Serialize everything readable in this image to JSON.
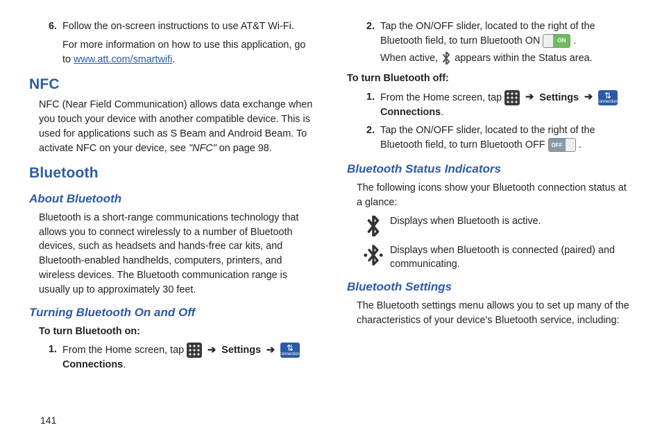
{
  "left": {
    "item6_a": "Follow the on-screen instructions to use AT&T Wi-Fi.",
    "item6_b": "For more information on how to use this application, go to ",
    "link": "www.att.com/smartwifi",
    "nfc_h": "NFC",
    "nfc_p1": "NFC (Near Field Communication) allows data exchange when you touch your device with another compatible device. This is used for applications such as S Beam and Android Beam. To activate NFC on your device, see ",
    "nfc_ref": "\"NFC\"",
    "nfc_p2": " on page 98.",
    "bt_h": "Bluetooth",
    "about_h": "About Bluetooth",
    "about_p": "Bluetooth is a short-range communications technology that allows you to connect wirelessly to a number of Bluetooth devices, such as headsets and hands-free car kits, and Bluetooth-enabled handhelds, computers, printers, and wireless devices. The Bluetooth communication range is usually up to approximately 30 feet.",
    "turn_h": "Turning Bluetooth On and Off",
    "turn_on_lbl": "To turn Bluetooth on:",
    "step1_a": "From the Home screen, tap ",
    "settings": "Settings",
    "connections": "Connections"
  },
  "right": {
    "step2_a": "Tap the ON/OFF slider, located to the right of the Bluetooth field, to turn Bluetooth ON ",
    "on_lbl": "ON",
    "step2_b": "When active, ",
    "step2_c": " appears within the Status area.",
    "turn_off_lbl": "To turn Bluetooth off:",
    "off_step1_a": "From the Home screen, tap ",
    "off_step2_a": "Tap the ON/OFF slider, located to the right of the Bluetooth field, to turn Bluetooth OFF ",
    "off_lbl": "OFF",
    "status_h": "Bluetooth Status Indicators",
    "status_p": "The following icons show your Bluetooth connection status at a glance:",
    "row1": "Displays when Bluetooth is active.",
    "row2": "Displays when Bluetooth is connected (paired) and communicating.",
    "settings_h": "Bluetooth Settings",
    "settings_p": "The Bluetooth settings menu allows you to set up many of the characteristics of your device's Bluetooth service, including:"
  },
  "pagenum": "141"
}
